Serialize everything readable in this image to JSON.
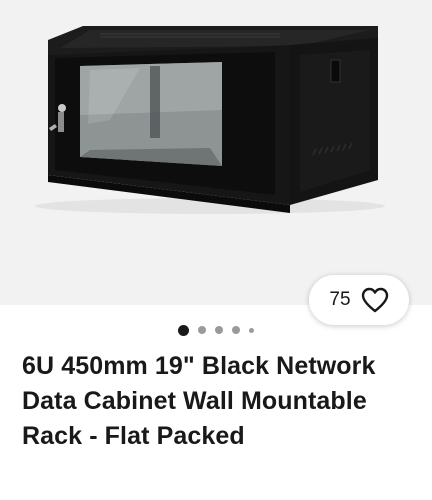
{
  "listing": {
    "title": "6U 450mm 19\" Black Network Data Cabinet Wall Mountable Rack - Flat Packed",
    "watchers": "75",
    "watch_icon": "heart-outline-icon",
    "gallery": {
      "image_subject": "black wall-mount network cabinet with glass door",
      "dots_count": 5,
      "active_dot": 1
    }
  }
}
